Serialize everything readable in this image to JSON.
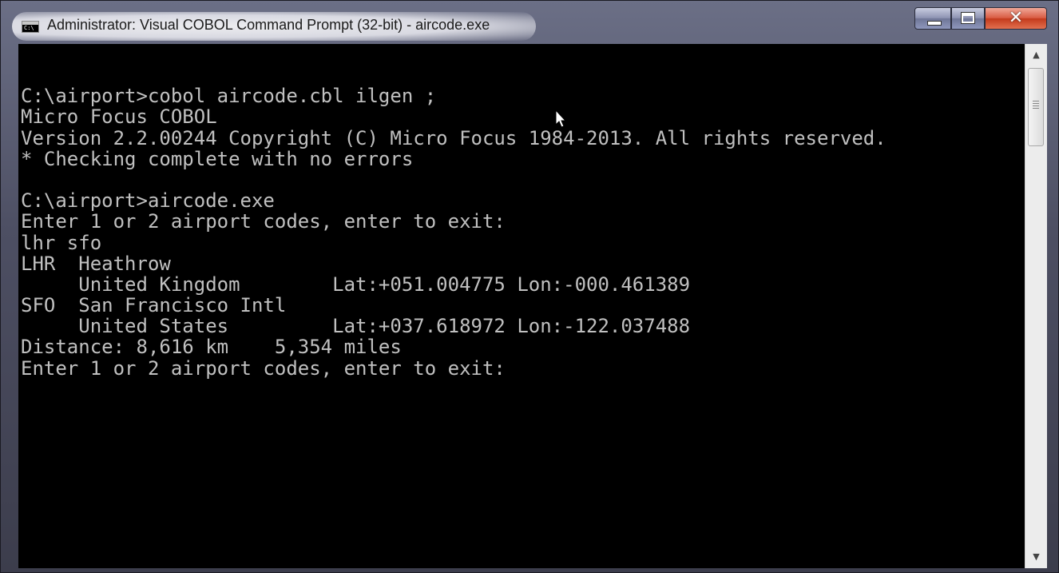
{
  "window": {
    "title": "Administrator: Visual COBOL Command Prompt (32-bit) - aircode.exe",
    "icon": "cmd-icon",
    "icon_text": "C:\\",
    "buttons": {
      "minimize": "minimize",
      "maximize": "maximize",
      "close": "✕"
    }
  },
  "console": {
    "lines": [
      "",
      "C:\\airport>cobol aircode.cbl ilgen ;",
      "Micro Focus COBOL",
      "Version 2.2.00244 Copyright (C) Micro Focus 1984-2013. All rights reserved.",
      "* Checking complete with no errors",
      "",
      "C:\\airport>aircode.exe",
      "Enter 1 or 2 airport codes, enter to exit:",
      "lhr sfo",
      "LHR  Heathrow",
      "     United Kingdom        Lat:+051.004775 Lon:-000.461389",
      "SFO  San Francisco Intl",
      "     United States         Lat:+037.618972 Lon:-122.037488",
      "Distance: 8,616 km    5,354 miles",
      "Enter 1 or 2 airport codes, enter to exit:"
    ],
    "text_color": "#c0c0c0",
    "background": "#000000"
  },
  "scrollbar": {
    "up_arrow": "▲",
    "down_arrow": "▼"
  }
}
